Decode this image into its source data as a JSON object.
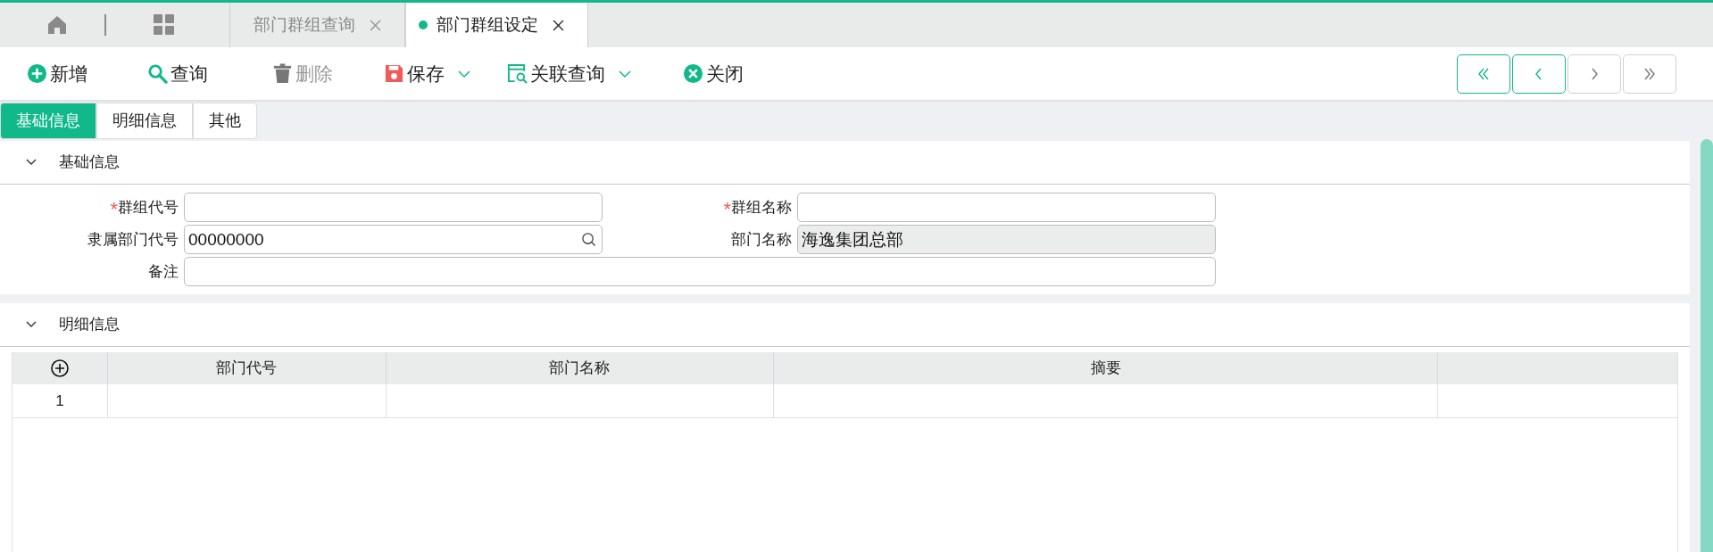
{
  "doc_tabs": [
    {
      "label": "部门群组查询",
      "selected": false
    },
    {
      "label": "部门群组设定",
      "selected": true
    }
  ],
  "toolbar": [
    {
      "kind": "add",
      "label": "新增",
      "disabled": false,
      "dropdown": false
    },
    {
      "kind": "search",
      "label": "查询",
      "disabled": false,
      "dropdown": false
    },
    {
      "kind": "delete",
      "label": "删除",
      "disabled": true,
      "dropdown": false
    },
    {
      "kind": "save",
      "label": "保存",
      "disabled": false,
      "dropdown": true
    },
    {
      "kind": "related",
      "label": "关联查询",
      "disabled": false,
      "dropdown": true
    },
    {
      "kind": "close",
      "label": "关闭",
      "disabled": false,
      "dropdown": false
    }
  ],
  "pager": [
    {
      "kind": "first",
      "disabled": false
    },
    {
      "kind": "prev",
      "disabled": false
    },
    {
      "kind": "next",
      "disabled": true
    },
    {
      "kind": "last",
      "disabled": true
    }
  ],
  "form_tabs": [
    {
      "label": "基础信息",
      "selected": true
    },
    {
      "label": "明细信息",
      "selected": false
    },
    {
      "label": "其他",
      "selected": false
    }
  ],
  "basic_section": {
    "title": "基础信息",
    "expanded": true,
    "fields": [
      {
        "kind": "text",
        "required_mark": "*",
        "label": "群组代号",
        "readonly": false
      },
      {
        "kind": "text",
        "required_mark": "*",
        "label": "群组名称",
        "readonly": false
      },
      {
        "kind": "lookup",
        "label": "隶属部门代号",
        "value": "00000000",
        "readonly": false
      },
      {
        "kind": "text",
        "label": "部门名称",
        "value": "海逸集团总部",
        "readonly": true
      },
      {
        "kind": "memo",
        "label": "备注",
        "readonly": false
      }
    ]
  },
  "detail_section": {
    "title": "明细信息",
    "expanded": true,
    "grid": {
      "columns": [
        "部门代号",
        "部门名称",
        "摘要"
      ],
      "rows": [
        {
          "number": "1"
        }
      ]
    }
  }
}
